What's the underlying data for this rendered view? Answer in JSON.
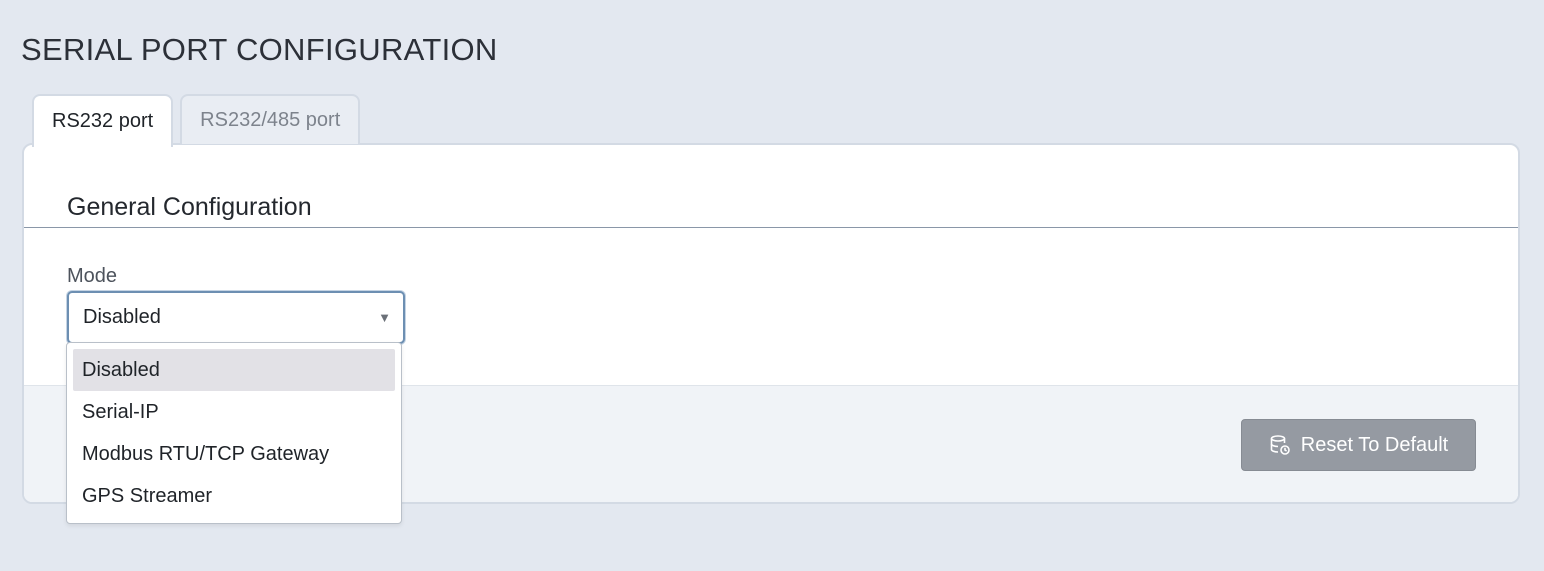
{
  "page": {
    "title": "SERIAL PORT CONFIGURATION"
  },
  "tabs": [
    {
      "label": "RS232 port",
      "active": true
    },
    {
      "label": "RS232/485 port",
      "active": false
    }
  ],
  "section": {
    "title": "General Configuration"
  },
  "mode": {
    "label": "Mode",
    "value": "Disabled",
    "caret_icon": "caret-down-icon",
    "options": [
      {
        "label": "Disabled",
        "selected": true
      },
      {
        "label": "Serial-IP",
        "selected": false
      },
      {
        "label": "Modbus RTU/TCP Gateway",
        "selected": false
      },
      {
        "label": "GPS Streamer",
        "selected": false
      }
    ]
  },
  "footer": {
    "reset_label": "Reset To Default",
    "reset_icon": "database-reset-icon"
  },
  "colors": {
    "page_background": "#e3e8f0",
    "card_background": "#ffffff",
    "button_background": "#959aa2",
    "select_focus_border": "#6d8fb2",
    "option_highlight": "#e2e1e6"
  }
}
